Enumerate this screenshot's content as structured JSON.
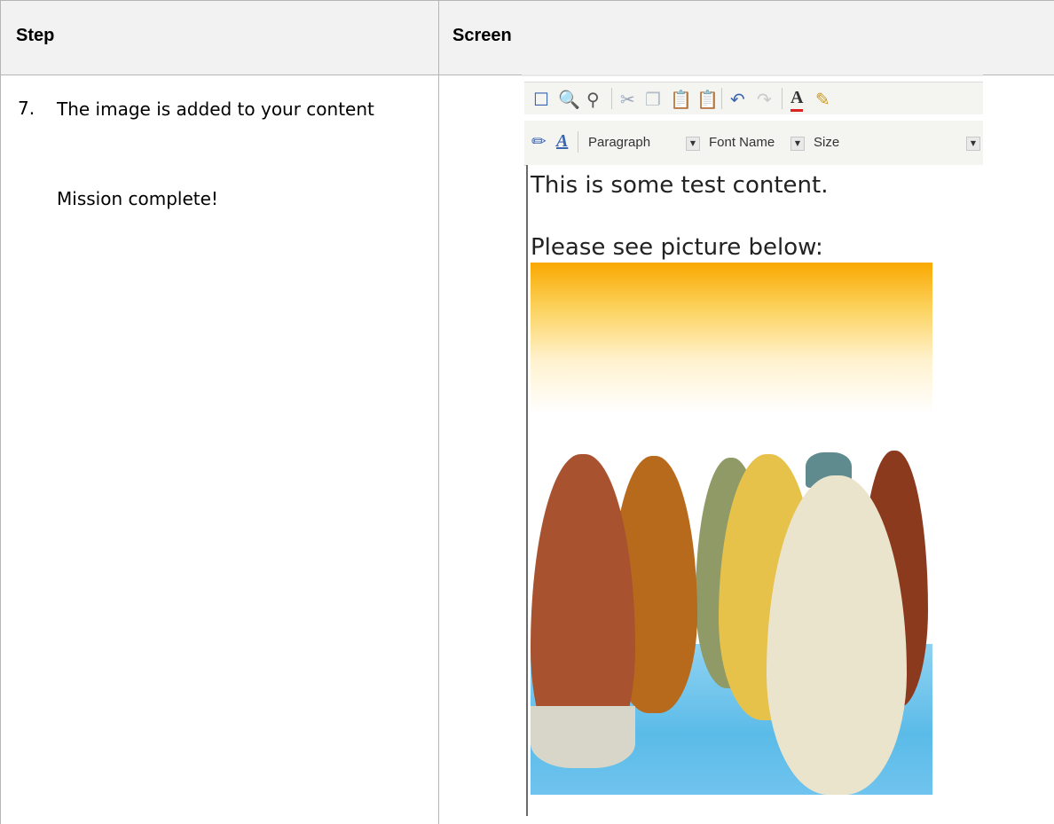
{
  "table": {
    "col_step": "Step",
    "col_screen": "Screen",
    "step_number": "7.",
    "step_text": "The image is added to your content",
    "note": "Mission complete!"
  },
  "editor": {
    "style_dropdown": "Paragraph",
    "font_dropdown": "Font Name",
    "size_dropdown": "Size",
    "line1": "This is some test content.",
    "line2": "Please see picture below:"
  }
}
